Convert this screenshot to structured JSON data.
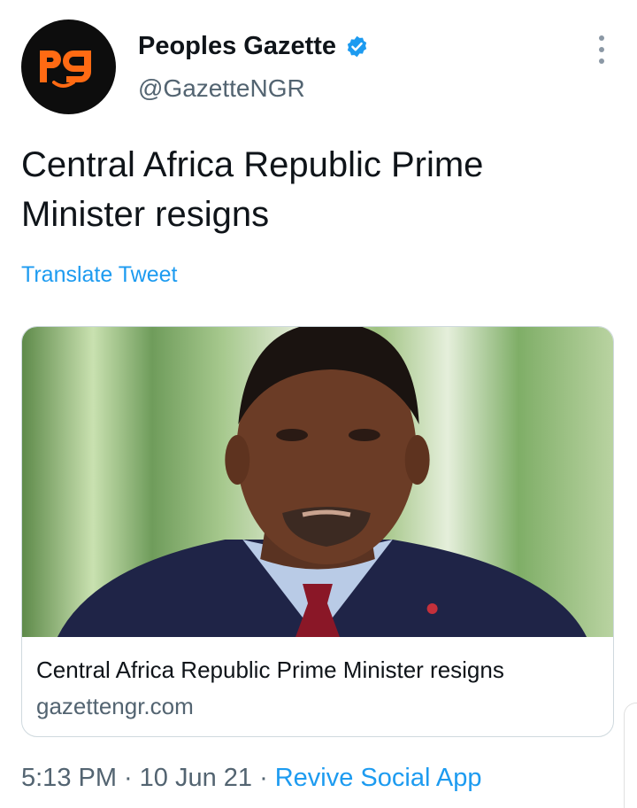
{
  "account": {
    "display_name": "Peoples Gazette",
    "handle": "@GazetteNGR",
    "logo_text": "pg",
    "verified": true
  },
  "tweet": {
    "text": "Central Africa Republic Prime Minister resigns",
    "translate_label": "Translate Tweet"
  },
  "card": {
    "title": "Central Africa Republic Prime Minister resigns",
    "domain": "gazettengr.com"
  },
  "meta": {
    "time": "5:13 PM",
    "date": "10 Jun 21",
    "separator": "·",
    "source": "Revive Social App"
  },
  "colors": {
    "link": "#1d9bf0",
    "brand_orange": "#ff6a13",
    "secondary_text": "#536471"
  },
  "icons": {
    "verified": "verified-badge-icon",
    "more": "more-vertical-icon"
  }
}
